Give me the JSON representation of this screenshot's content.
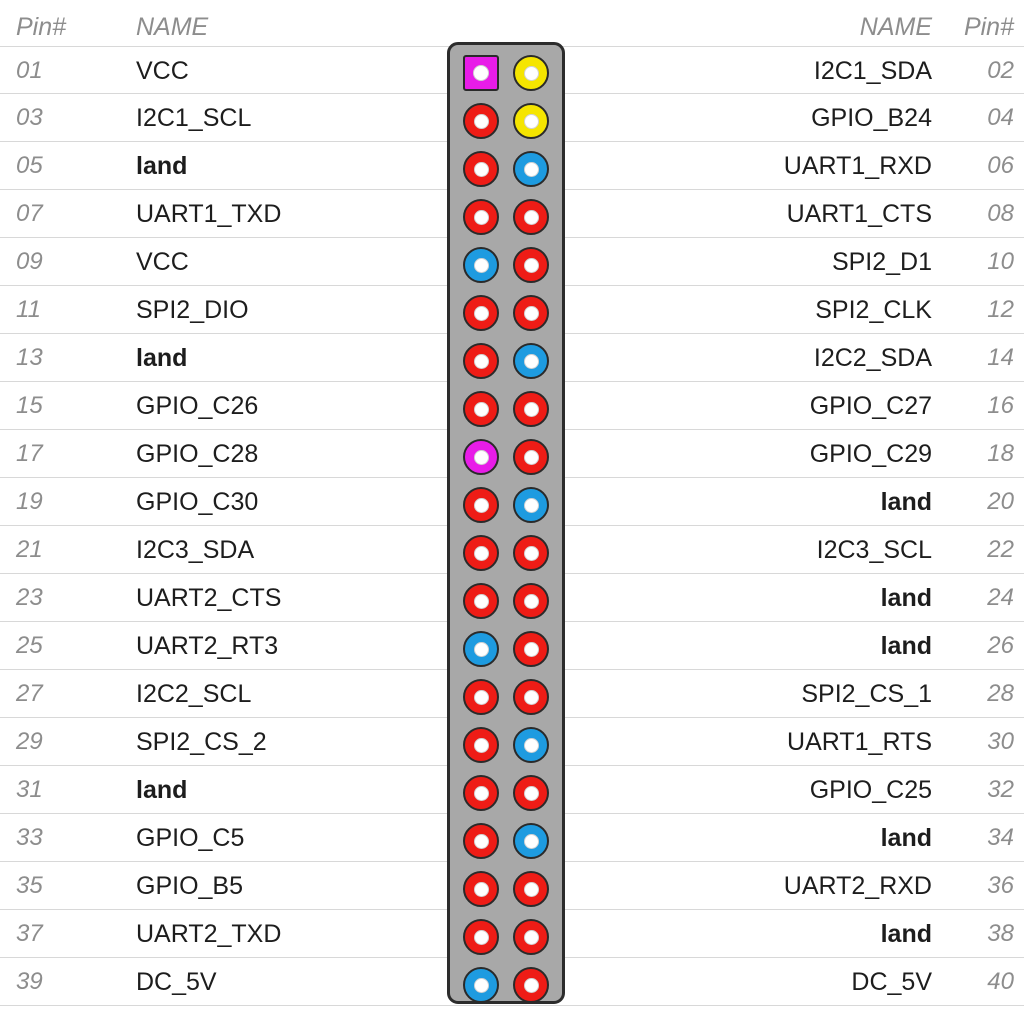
{
  "header": {
    "pin_left": "Pin#",
    "name_left": "NAME",
    "name_right": "NAME",
    "pin_right": "Pin#"
  },
  "colors": {
    "red": "#ee1c16",
    "yellow": "#f5e500",
    "blue": "#1e9be0",
    "magenta": "#e81ce8",
    "connector_body": "#a8a8a8",
    "connector_border": "#2c2c2c",
    "pin_border": "#2a2a2a",
    "hole": "#ffffff",
    "row_line": "#d8d8d8",
    "header_text": "#8d8d8d",
    "name_text": "#1d1d1d"
  },
  "chart_data": {
    "type": "table",
    "title": "40-pin GPIO header pinout",
    "columns": [
      "Pin#",
      "NAME",
      "pad_left",
      "pad_right",
      "NAME",
      "Pin#"
    ],
    "rows": [
      {
        "pin_left": "01",
        "name_left": "VCC",
        "gnd_left": false,
        "pad_left": {
          "color": "magenta",
          "shape": "square"
        },
        "pad_right": {
          "color": "yellow",
          "shape": "round"
        },
        "name_right": "I2C1_SDA",
        "gnd_right": false,
        "pin_right": "02"
      },
      {
        "pin_left": "03",
        "name_left": "I2C1_SCL",
        "gnd_left": false,
        "pad_left": {
          "color": "red",
          "shape": "round"
        },
        "pad_right": {
          "color": "yellow",
          "shape": "round"
        },
        "name_right": "GPIO_B24",
        "gnd_right": false,
        "pin_right": "04"
      },
      {
        "pin_left": "05",
        "name_left": "land",
        "gnd_left": true,
        "pad_left": {
          "color": "red",
          "shape": "round"
        },
        "pad_right": {
          "color": "blue",
          "shape": "round"
        },
        "name_right": "UART1_RXD",
        "gnd_right": false,
        "pin_right": "06"
      },
      {
        "pin_left": "07",
        "name_left": "UART1_TXD",
        "gnd_left": false,
        "pad_left": {
          "color": "red",
          "shape": "round"
        },
        "pad_right": {
          "color": "red",
          "shape": "round"
        },
        "name_right": "UART1_CTS",
        "gnd_right": false,
        "pin_right": "08"
      },
      {
        "pin_left": "09",
        "name_left": "VCC",
        "gnd_left": false,
        "pad_left": {
          "color": "blue",
          "shape": "round"
        },
        "pad_right": {
          "color": "red",
          "shape": "round"
        },
        "name_right": "SPI2_D1",
        "gnd_right": false,
        "pin_right": "10"
      },
      {
        "pin_left": "11",
        "name_left": "SPI2_DIO",
        "gnd_left": false,
        "pad_left": {
          "color": "red",
          "shape": "round"
        },
        "pad_right": {
          "color": "red",
          "shape": "round"
        },
        "name_right": "SPI2_CLK",
        "gnd_right": false,
        "pin_right": "12"
      },
      {
        "pin_left": "13",
        "name_left": "land",
        "gnd_left": true,
        "pad_left": {
          "color": "red",
          "shape": "round"
        },
        "pad_right": {
          "color": "blue",
          "shape": "round"
        },
        "name_right": "I2C2_SDA",
        "gnd_right": false,
        "pin_right": "14"
      },
      {
        "pin_left": "15",
        "name_left": "GPIO_C26",
        "gnd_left": false,
        "pad_left": {
          "color": "red",
          "shape": "round"
        },
        "pad_right": {
          "color": "red",
          "shape": "round"
        },
        "name_right": "GPIO_C27",
        "gnd_right": false,
        "pin_right": "16"
      },
      {
        "pin_left": "17",
        "name_left": "GPIO_C28",
        "gnd_left": false,
        "pad_left": {
          "color": "magenta",
          "shape": "round"
        },
        "pad_right": {
          "color": "red",
          "shape": "round"
        },
        "name_right": "GPIO_C29",
        "gnd_right": false,
        "pin_right": "18"
      },
      {
        "pin_left": "19",
        "name_left": "GPIO_C30",
        "gnd_left": false,
        "pad_left": {
          "color": "red",
          "shape": "round"
        },
        "pad_right": {
          "color": "blue",
          "shape": "round"
        },
        "name_right": "land",
        "gnd_right": true,
        "pin_right": "20"
      },
      {
        "pin_left": "21",
        "name_left": "I2C3_SDA",
        "gnd_left": false,
        "pad_left": {
          "color": "red",
          "shape": "round"
        },
        "pad_right": {
          "color": "red",
          "shape": "round"
        },
        "name_right": "I2C3_SCL",
        "gnd_right": false,
        "pin_right": "22"
      },
      {
        "pin_left": "23",
        "name_left": "UART2_CTS",
        "gnd_left": false,
        "pad_left": {
          "color": "red",
          "shape": "round"
        },
        "pad_right": {
          "color": "red",
          "shape": "round"
        },
        "name_right": "land",
        "gnd_right": true,
        "pin_right": "24"
      },
      {
        "pin_left": "25",
        "name_left": "UART2_RT3",
        "gnd_left": false,
        "pad_left": {
          "color": "blue",
          "shape": "round"
        },
        "pad_right": {
          "color": "red",
          "shape": "round"
        },
        "name_right": "land",
        "gnd_right": true,
        "pin_right": "26"
      },
      {
        "pin_left": "27",
        "name_left": "I2C2_SCL",
        "gnd_left": false,
        "pad_left": {
          "color": "red",
          "shape": "round"
        },
        "pad_right": {
          "color": "red",
          "shape": "round"
        },
        "name_right": "SPI2_CS_1",
        "gnd_right": false,
        "pin_right": "28"
      },
      {
        "pin_left": "29",
        "name_left": "SPI2_CS_2",
        "gnd_left": false,
        "pad_left": {
          "color": "red",
          "shape": "round"
        },
        "pad_right": {
          "color": "blue",
          "shape": "round"
        },
        "name_right": "UART1_RTS",
        "gnd_right": false,
        "pin_right": "30"
      },
      {
        "pin_left": "31",
        "name_left": "land",
        "gnd_left": true,
        "pad_left": {
          "color": "red",
          "shape": "round"
        },
        "pad_right": {
          "color": "red",
          "shape": "round"
        },
        "name_right": "GPIO_C25",
        "gnd_right": false,
        "pin_right": "32"
      },
      {
        "pin_left": "33",
        "name_left": "GPIO_C5",
        "gnd_left": false,
        "pad_left": {
          "color": "red",
          "shape": "round"
        },
        "pad_right": {
          "color": "blue",
          "shape": "round"
        },
        "name_right": "land",
        "gnd_right": true,
        "pin_right": "34"
      },
      {
        "pin_left": "35",
        "name_left": "GPIO_B5",
        "gnd_left": false,
        "pad_left": {
          "color": "red",
          "shape": "round"
        },
        "pad_right": {
          "color": "red",
          "shape": "round"
        },
        "name_right": "UART2_RXD",
        "gnd_right": false,
        "pin_right": "36"
      },
      {
        "pin_left": "37",
        "name_left": "UART2_TXD",
        "gnd_left": false,
        "pad_left": {
          "color": "red",
          "shape": "round"
        },
        "pad_right": {
          "color": "red",
          "shape": "round"
        },
        "name_right": "land",
        "gnd_right": true,
        "pin_right": "38"
      },
      {
        "pin_left": "39",
        "name_left": "DC_5V",
        "gnd_left": false,
        "pad_left": {
          "color": "blue",
          "shape": "round"
        },
        "pad_right": {
          "color": "red",
          "shape": "round"
        },
        "name_right": "DC_5V",
        "gnd_right": false,
        "pin_right": "40"
      }
    ]
  }
}
